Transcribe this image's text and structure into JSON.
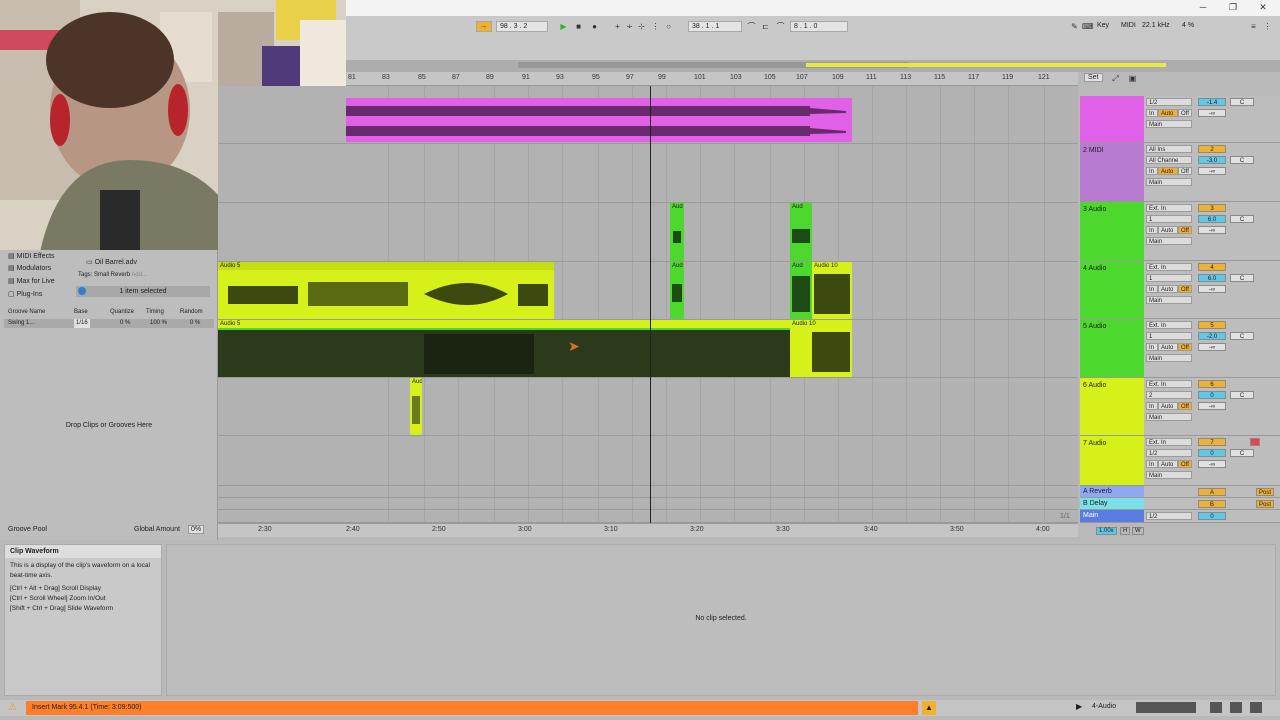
{
  "window": {
    "minimize": "─",
    "restore": "❐",
    "close": "✕"
  },
  "transport": {
    "tempo": "98 . 3 . 2",
    "position": "38 . 1 . 1",
    "loop_length": "8 . 1 . 0",
    "key_label": "Key",
    "midi_label": "MIDI",
    "sample_rate": "22.1 kHz",
    "cpu": "4 %"
  },
  "ruler": {
    "bars": [
      "81",
      "83",
      "85",
      "87",
      "89",
      "91",
      "93",
      "95",
      "97",
      "99",
      "101",
      "103",
      "105",
      "107",
      "109",
      "111",
      "113",
      "115",
      "117",
      "119",
      "121"
    ],
    "set_label": "Set"
  },
  "time_ruler": {
    "times": [
      "2:30",
      "2:40",
      "2:50",
      "3:00",
      "3:10",
      "3:20",
      "3:30",
      "3:40",
      "3:50",
      "4:00"
    ]
  },
  "tracks": [
    {
      "name": "",
      "color": "#e060e8",
      "input": "1/2",
      "in": "In",
      "auto": "Auto",
      "off": "Off",
      "out": "Main",
      "num": "1",
      "vol": "-1.4",
      "pan": "C",
      "send": "-∞"
    },
    {
      "name": "2 MIDI",
      "color": "#b87ad0",
      "input": "All Ins",
      "input2": "All Channe",
      "in": "In",
      "auto": "Auto",
      "off": "Off",
      "out": "Main",
      "num": "2",
      "vol": "-3.0",
      "pan": "C",
      "send": "-∞"
    },
    {
      "name": "3 Audio",
      "color": "#4cd82c",
      "input": "Ext. In",
      "input2": "1",
      "in": "In",
      "auto": "Auto",
      "off": "Off",
      "out": "Main",
      "num": "3",
      "vol": "6.0",
      "pan": "C",
      "send": "-∞"
    },
    {
      "name": "4 Audio",
      "color": "#4cd82c",
      "input": "Ext. In",
      "input2": "1",
      "in": "In",
      "auto": "Auto",
      "off": "Off",
      "out": "Main",
      "num": "4",
      "vol": "6.0",
      "pan": "C",
      "send": "-∞"
    },
    {
      "name": "5 Audio",
      "color": "#4cd82c",
      "input": "Ext. In",
      "input2": "1",
      "in": "In",
      "auto": "Auto",
      "off": "Off",
      "out": "Main",
      "num": "5",
      "vol": "-2.0",
      "pan": "C",
      "send": "-∞"
    },
    {
      "name": "6 Audio",
      "color": "#d6f019",
      "input": "Ext. In",
      "input2": "2",
      "in": "In",
      "auto": "Auto",
      "off": "Off",
      "out": "Main",
      "num": "6",
      "vol": "0",
      "pan": "C",
      "send": "-∞"
    },
    {
      "name": "7 Audio",
      "color": "#d6f019",
      "input": "Ext. In",
      "input2": "1/2",
      "in": "In",
      "auto": "Auto",
      "off": "Off",
      "out": "Main",
      "num": "7",
      "vol": "0",
      "pan": "C",
      "send": "-∞"
    }
  ],
  "returns": [
    {
      "name": "A Reverb",
      "color": "#8fa8f0",
      "num": "A",
      "post": "Post"
    },
    {
      "name": "B Delay",
      "color": "#7be0e8",
      "num": "B",
      "post": "Post"
    },
    {
      "name": "Main",
      "color": "#5a7be0",
      "input": "1/2",
      "num": "0"
    }
  ],
  "clips": {
    "audio": "Aud",
    "audio5": "Audio 5",
    "audio10": "Audio 10",
    "a": "A"
  },
  "browser": {
    "items": [
      "MIDI Effects",
      "Modulators",
      "Max for Live",
      "Plug-Ins"
    ],
    "file": "Oil Barrel.adv",
    "tags_label": "Tags:",
    "tag": "Small Reverb",
    "add": "Add...",
    "selected": "1 item selected",
    "groove_cols": [
      "Groove Name",
      "Base",
      "Quantize",
      "Timing",
      "Random"
    ],
    "groove_row": {
      "name": "Swing 1...",
      "base": "1/16",
      "quantize": "0 %",
      "timing": "100 %",
      "random": "0 %"
    },
    "drop_hint": "Drop Clips or Grooves Here",
    "groove_pool": "Groove Pool",
    "global_amount_label": "Global Amount",
    "global_amount": "0%"
  },
  "info": {
    "title": "Clip Waveform",
    "line1": "This is a display of the clip's waveform on a local beat-time axis.",
    "line2": "[Ctrl + Alt + Drag] Scroll Display",
    "line3": "[Ctrl + Scroll Wheel] Zoom In/Out",
    "line4": "[Shift + Ctrl + Drag] Slide Waveform"
  },
  "detail": {
    "empty": "No clip selected."
  },
  "status": {
    "message": "Insert Mark 95.4.1 (Time: 3:09:500)",
    "track": "4-Audio"
  },
  "mixer_footer": {
    "zoom": "1.00x",
    "h": "H",
    "w": "W",
    "page": "1/1"
  }
}
